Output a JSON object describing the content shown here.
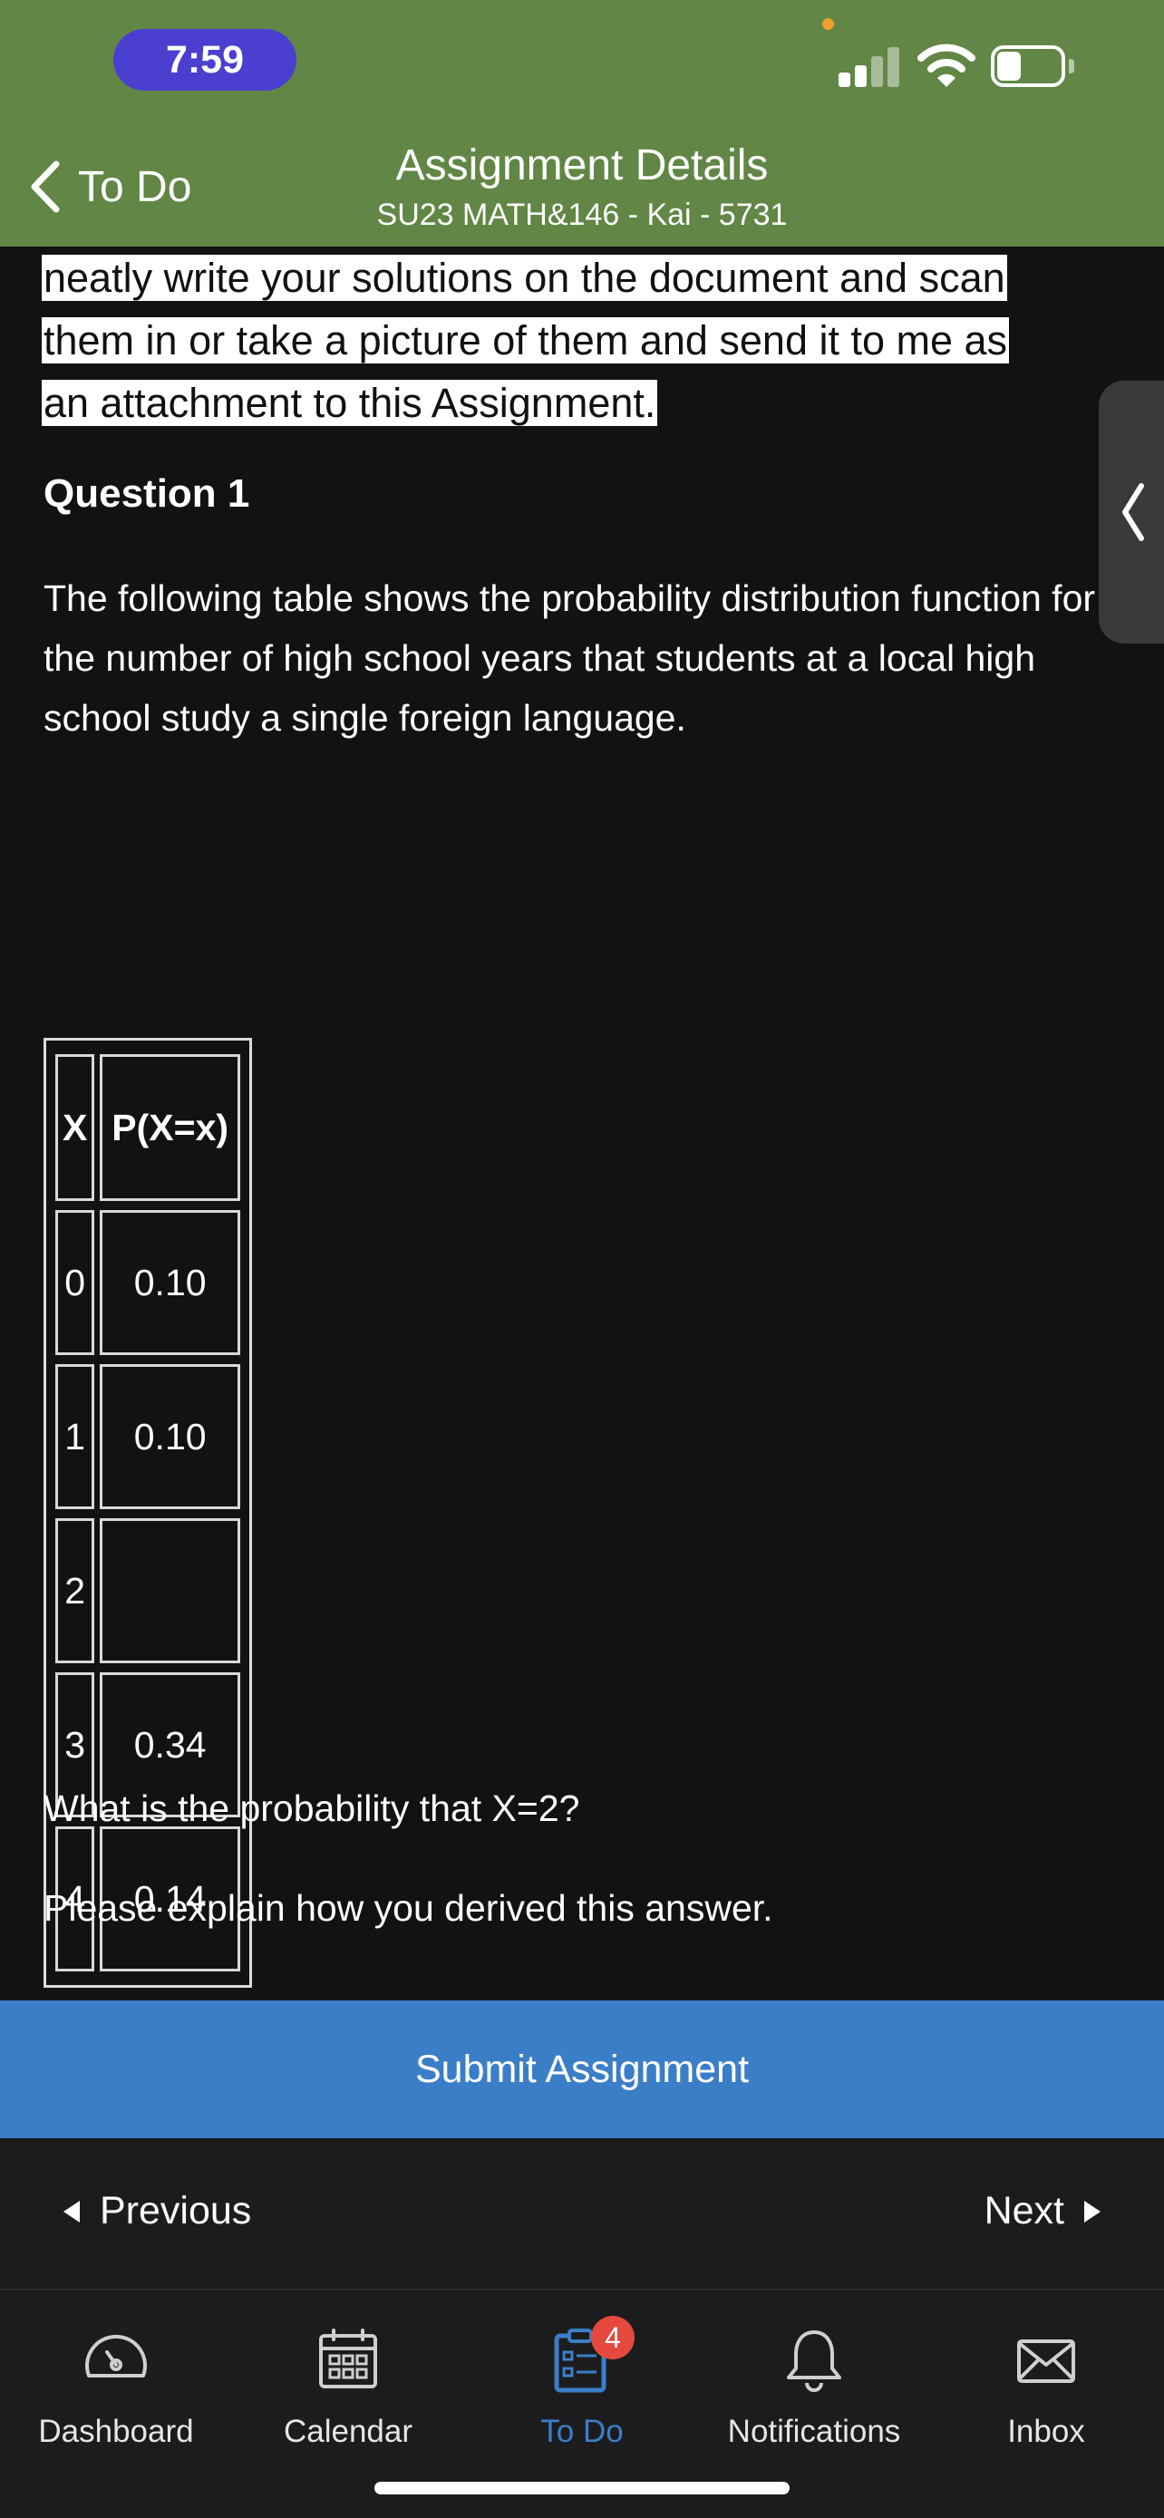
{
  "status_bar": {
    "time": "7:59"
  },
  "header": {
    "back_label": "To Do",
    "title": "Assignment Details",
    "subtitle": "SU23 MATH&146 - Kai - 5731",
    "background_color": "#618645"
  },
  "content": {
    "highlighted_lines": [
      "neatly write your solutions on the document and scan",
      "them in or take a picture of them and send it to me as",
      "an attachment to this Assignment."
    ],
    "question_title": "Question 1",
    "question_text": "The following table shows the probability distribution function for the number of high school years that students at a local high school study a single foreign language.",
    "table": {
      "headers": [
        "X",
        "P(X=x)"
      ],
      "rows": [
        {
          "x": "0",
          "p": "0.10"
        },
        {
          "x": "1",
          "p": "0.10"
        },
        {
          "x": "2",
          "p": ""
        },
        {
          "x": "3",
          "p": "0.34"
        },
        {
          "x": "4",
          "p": "0.14"
        }
      ]
    },
    "answer_question": "What is the probability that X=2?",
    "explain_text": "Please explain how you derived this answer."
  },
  "actions": {
    "submit_label": "Submit Assignment",
    "submit_color": "#3b7ec8",
    "previous_label": "Previous",
    "next_label": "Next"
  },
  "tabbar": {
    "items": [
      {
        "label": "Dashboard",
        "icon": "gauge-icon"
      },
      {
        "label": "Calendar",
        "icon": "calendar-icon"
      },
      {
        "label": "To Do",
        "icon": "clipboard-icon",
        "badge": "4",
        "active": true
      },
      {
        "label": "Notifications",
        "icon": "bell-icon"
      },
      {
        "label": "Inbox",
        "icon": "envelope-icon"
      }
    ],
    "active_color": "#3b7ec8",
    "badge_color": "#e5483c"
  }
}
